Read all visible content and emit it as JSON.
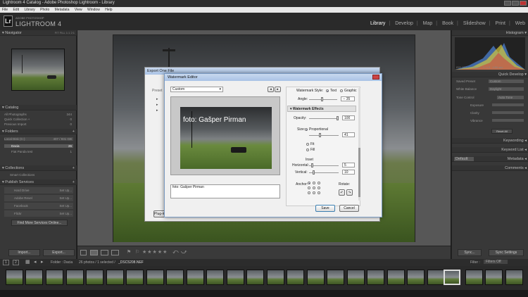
{
  "window": {
    "title": "Lightroom 4 Catalog - Adobe Photoshop Lightroom - Library"
  },
  "menu": [
    "File",
    "Edit",
    "Library",
    "Photo",
    "Metadata",
    "View",
    "Window",
    "Help"
  ],
  "app": {
    "adobe_label": "ADOBE PHOTOSHOP",
    "name": "LIGHTROOM 4",
    "logo": "Lr"
  },
  "modules": [
    "Library",
    "Develop",
    "Map",
    "Book",
    "Slideshow",
    "Print",
    "Web"
  ],
  "left": {
    "navigator": {
      "title": "Navigator",
      "zoom": [
        "FIT",
        "FILL",
        "1:1",
        "2:1"
      ]
    },
    "catalog": {
      "title": "Catalog",
      "items": [
        {
          "label": "All Photographs",
          "count": "344"
        },
        {
          "label": "Quick Collection +",
          "count": "0"
        },
        {
          "label": "Previous Import",
          "count": "0"
        }
      ]
    },
    "folders": {
      "title": "Folders",
      "volume": {
        "label": "Local Disk (C:)",
        "info": "407 / 931 GB"
      },
      "items": [
        {
          "label": "Dacia",
          "count": "26"
        },
        {
          "label": "Fiat Panda test",
          "count": "1"
        }
      ]
    },
    "collections": {
      "title": "Collections",
      "items": [
        {
          "label": "Smart Collections"
        }
      ]
    },
    "publish": {
      "title": "Publish Services",
      "items": [
        {
          "label": "Hard Drive",
          "action": "Set Up..."
        },
        {
          "label": "Adobe Revel",
          "action": "Set Up..."
        },
        {
          "label": "Facebook",
          "action": "Set Up..."
        },
        {
          "label": "Flickr",
          "action": "Set Up..."
        }
      ],
      "find_more": "Find More Services Online..."
    },
    "import_label": "Import...",
    "export_label": "Export..."
  },
  "right": {
    "histogram": {
      "title": "Histogram",
      "readout": [
        "ISO 100",
        "35mm",
        "f / 4.5",
        "1/50 sec"
      ]
    },
    "quick_develop": {
      "title": "Quick Develop",
      "saved_preset": {
        "label": "Saved Preset",
        "value": "Custom"
      },
      "white_balance": {
        "label": "White Balance",
        "value": "Daylight"
      },
      "tone_control": {
        "label": "Tone Control",
        "value": "Auto Tone"
      },
      "sliders": [
        "Exposure",
        "Clarity",
        "Vibrance"
      ],
      "reset": "Reset All"
    },
    "keywording": "Keywording",
    "keyword_list": "Keyword List",
    "metadata": {
      "title": "Metadata",
      "preset": "Default"
    },
    "comments": "Comments",
    "sync_label": "Sync...",
    "sync_settings_label": "Sync Settings"
  },
  "filmstrip": {
    "pages": [
      "1",
      "2"
    ],
    "source": "Folder : Dacia",
    "info": "26 photos / 1 selected /",
    "filename": "_DSC5208.NEF",
    "filter_label": "Filter :",
    "filter_value": "Filters Off"
  },
  "export_dialog": {
    "title": "Export One File",
    "partial_label": "Preset",
    "plugin_label": "Plug-in Manager..."
  },
  "watermark": {
    "title": "Watermark Editor",
    "preset": "Custom",
    "style_label": "Watermark Style:",
    "style_text": "Text",
    "style_graphic": "Graphic",
    "angle_label": "Angle:",
    "angle_value": "-- 35",
    "effects_title": "Watermark Effects",
    "opacity_label": "Opacity:",
    "opacity_value": "100",
    "size_label": "Size:",
    "size_proportional": "Proportional",
    "size_value": "41",
    "size_fit": "Fit",
    "size_fill": "Fill",
    "inset_label": "Inset",
    "horizontal_label": "Horizontal:",
    "horizontal_value": "5",
    "vertical_label": "Vertical:",
    "vertical_value": "10",
    "anchor_label": "Anchor:",
    "rotate_label": "Rotate:",
    "text": "foto: Gašper Pirman",
    "save": "Save",
    "cancel": "Cancel"
  },
  "colors": {
    "accent": "#b5b5b5",
    "panel": "#383838",
    "photo_bg": "#575757"
  }
}
